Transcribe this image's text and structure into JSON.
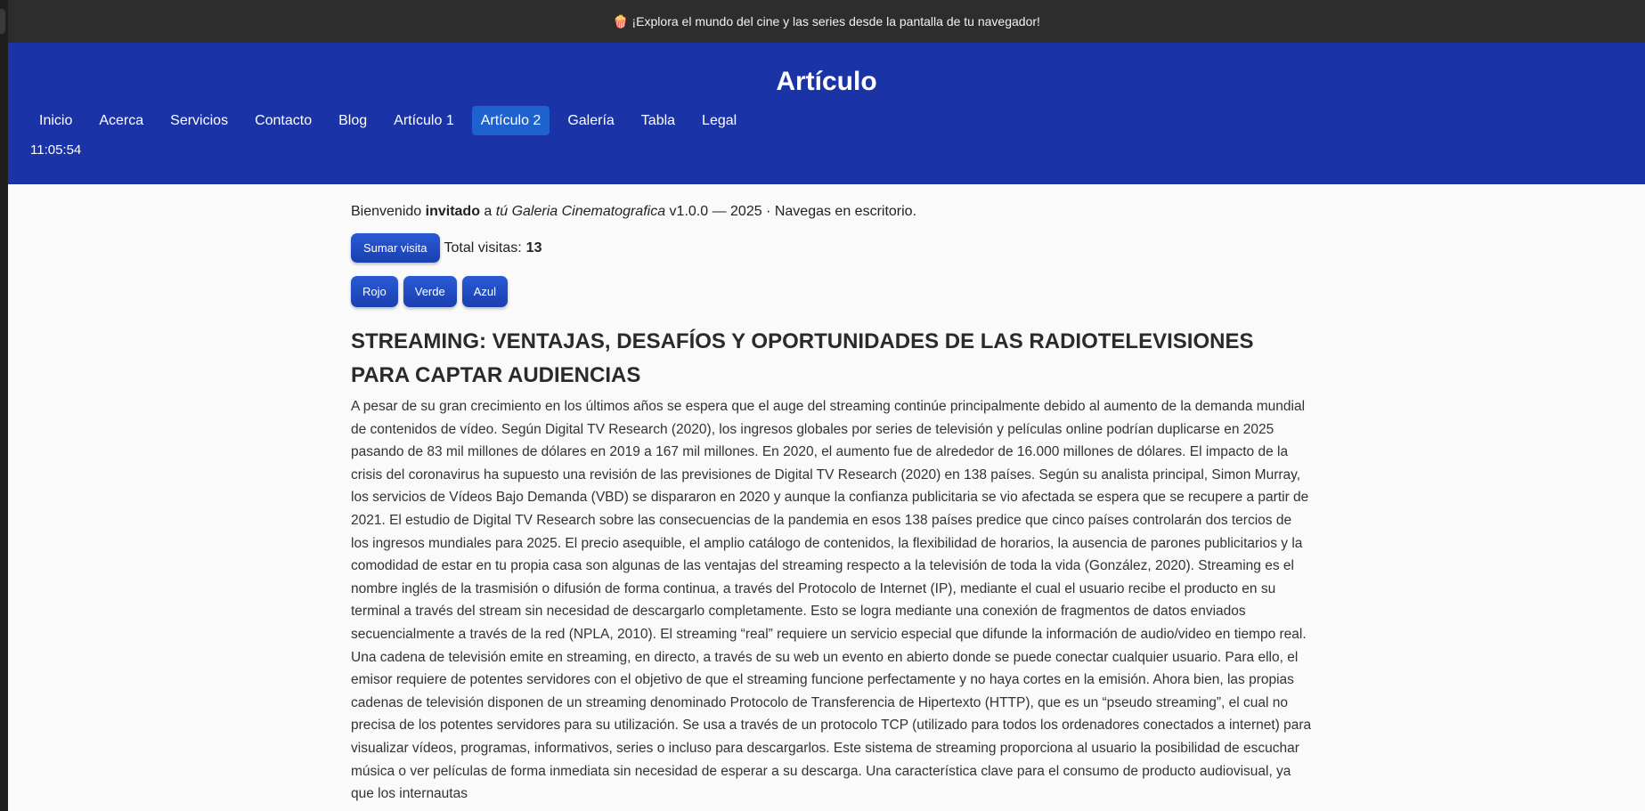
{
  "announcement": {
    "icon": "popcorn-icon",
    "text": "¡Explora el mundo del cine y las series desde la pantalla de tu navegador!"
  },
  "header": {
    "title": "Artículo",
    "nav": [
      {
        "label": "Inicio"
      },
      {
        "label": "Acerca"
      },
      {
        "label": "Servicios"
      },
      {
        "label": "Contacto"
      },
      {
        "label": "Blog"
      },
      {
        "label": "Artículo 1"
      },
      {
        "label": "Artículo 2",
        "active": true
      },
      {
        "label": "Galería"
      },
      {
        "label": "Tabla"
      },
      {
        "label": "Legal"
      }
    ],
    "clock": "11:05:54",
    "colors": {
      "background": "#1a33a6",
      "active_item": "#1e62d0"
    }
  },
  "welcome": {
    "prefix": "Bienvenido",
    "user": "invitado",
    "connector": "a",
    "site_name": "tú Galeria Cinematografica",
    "suffix": "v1.0.0 — 2025 · Navegas en escritorio."
  },
  "visits": {
    "button_label": "Sumar visita",
    "label": "Total visitas:",
    "count": "13"
  },
  "color_buttons": {
    "red": "Rojo",
    "green": "Verde",
    "blue": "Azul"
  },
  "article": {
    "title": "STREAMING: VENTAJAS, DESAFÍOS Y OPORTUNIDADES DE LAS RADIOTELEVISIONES PARA CAPTAR AUDIENCIAS",
    "body": "A pesar de su gran crecimiento en los últimos años se espera que el auge del streaming continúe principalmente debido al aumento de la demanda mundial de contenidos de vídeo. Según Digital TV Research (2020), los ingresos globales por series de televisión y películas online podrían duplicarse en 2025 pasando de 83 mil millones de dólares en 2019 a 167 mil millones. En 2020, el aumento fue de alrededor de 16.000 millones de dólares. El impacto de la crisis del coronavirus ha supuesto una revisión de las previsiones de Digital TV Research (2020) en 138 países. Según su analista principal, Simon Murray, los servicios de Vídeos Bajo Demanda (VBD) se dispararon en 2020 y aunque la confianza publicitaria se vio afectada se espera que se recupere a partir de 2021. El estudio de Digital TV Research sobre las consecuencias de la pandemia en esos 138 países predice que cinco países controlarán dos tercios de los ingresos mundiales para 2025. El precio asequible, el amplio catálogo de contenidos, la flexibilidad de horarios, la ausencia de parones publicitarios y la comodidad de estar en tu propia casa son algunas de las ventajas del streaming respecto a la televisión de toda la vida (González, 2020). Streaming es el nombre inglés de la trasmisión o difusión de forma continua, a través del Protocolo de Internet (IP), mediante el cual el usuario recibe el producto en su terminal a través del stream sin necesidad de descargarlo completamente. Esto se logra mediante una conexión de fragmentos de datos enviados secuencialmente a través de la red (NPLA, 2010). El streaming “real” requiere un servicio especial que difunde la información de audio/video en tiempo real. Una cadena de televisión emite en streaming, en directo, a través de su web un evento en abierto donde se puede conectar cualquier usuario. Para ello, el emisor requiere de potentes servidores con el objetivo de que el streaming funcione perfectamente y no haya cortes en la emisión. Ahora bien, las propias cadenas de televisión disponen de un streaming denominado Protocolo de Transferencia de Hipertexto (HTTP), que es un “pseudo streaming”, el cual no precisa de los potentes servidores para su utilización. Se usa a través de un protocolo TCP (utilizado para todos los ordenadores conectados a internet) para visualizar vídeos, programas, informativos, series o incluso para descargarlos. Este sistema de streaming proporciona al usuario la posibilidad de escuchar música o ver películas de forma inmediata sin necesidad de esperar a su descarga. Una característica clave para el consumo de producto audiovisual, ya que los internautas"
  }
}
